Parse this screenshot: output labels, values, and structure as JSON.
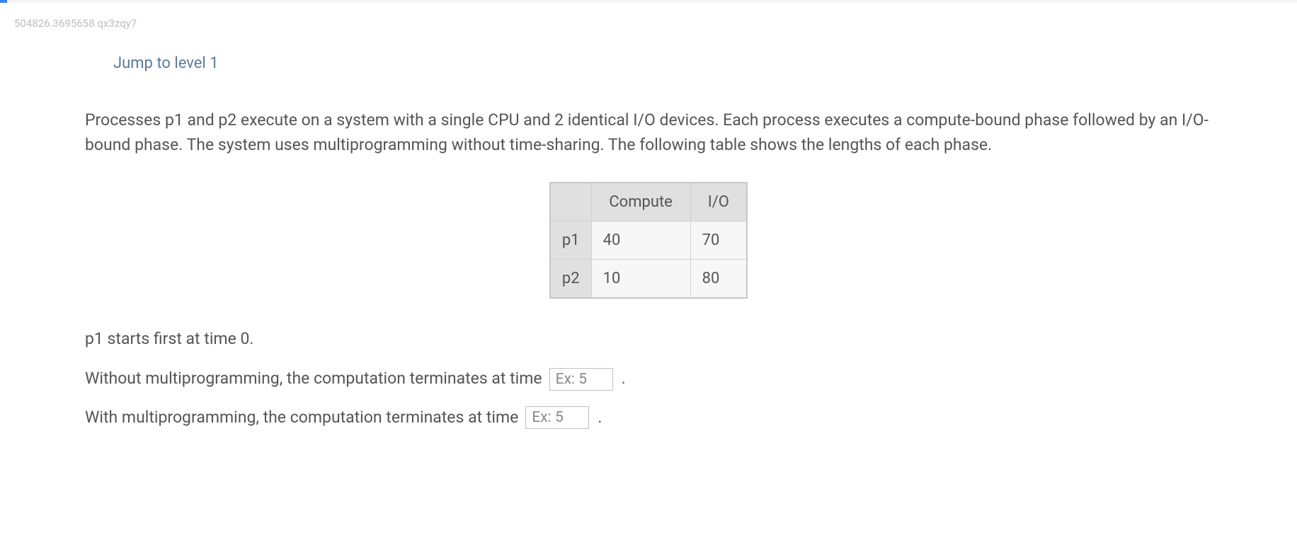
{
  "qid": "504826.3695658.qx3zqy7",
  "jump_link_label": "Jump to level 1",
  "prompt": "Processes p1 and p2 execute on a system with a single CPU and 2 identical I/O devices. Each process executes a compute-bound phase followed by an I/O-bound phase. The system uses multiprogramming without time-sharing. The following table shows the lengths of each phase.",
  "table": {
    "headers": {
      "blank": "",
      "compute": "Compute",
      "io": "I/O"
    },
    "rows": [
      {
        "label": "p1",
        "compute": "40",
        "io": "70"
      },
      {
        "label": "p2",
        "compute": "10",
        "io": "80"
      }
    ]
  },
  "start_note": "p1 starts first at time 0.",
  "line1": {
    "text": "Without multiprogramming, the computation terminates at time",
    "placeholder": "Ex: 5",
    "period": "."
  },
  "line2": {
    "text": "With multiprogramming, the computation terminates at time",
    "placeholder": "Ex: 5",
    "period": "."
  }
}
